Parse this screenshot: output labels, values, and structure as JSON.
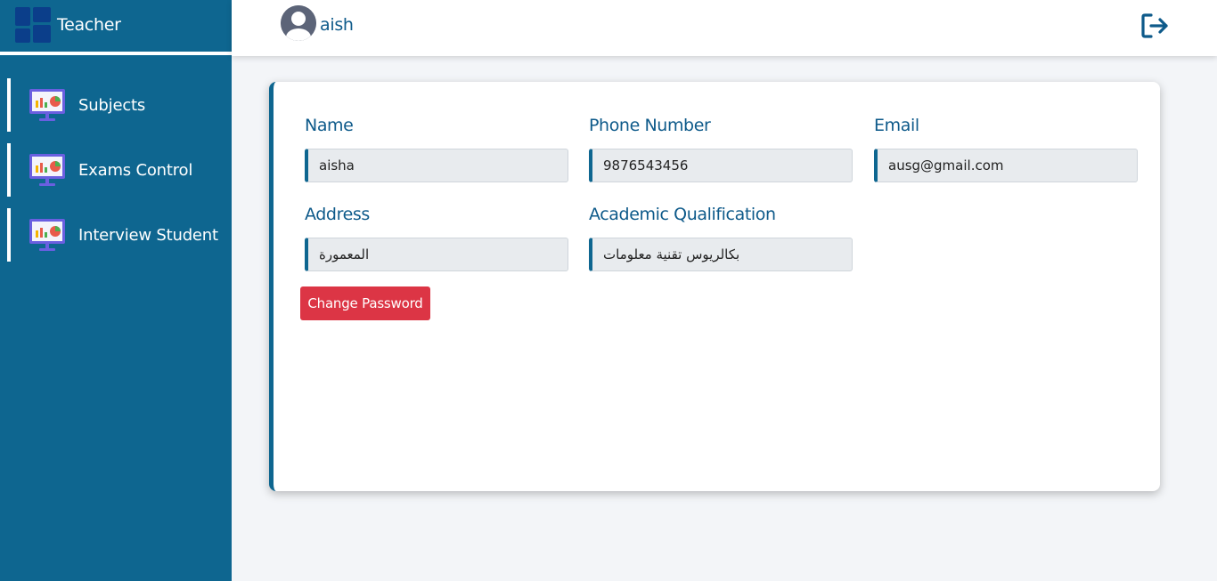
{
  "sidebar": {
    "brand_title": "Teacher",
    "items": [
      {
        "label": "Subjects",
        "icon": "presentation-chart-icon"
      },
      {
        "label": "Exams Control",
        "icon": "presentation-chart-icon"
      },
      {
        "label": "Interview Student",
        "icon": "presentation-chart-icon"
      }
    ]
  },
  "header": {
    "username": "aish",
    "avatar_icon": "user-avatar-icon",
    "logout_icon": "logout-icon"
  },
  "profile": {
    "name": {
      "label": "Name",
      "value": "aisha"
    },
    "phone": {
      "label": "Phone Number",
      "value": "9876543456"
    },
    "email": {
      "label": "Email",
      "value": "ausg@gmail.com"
    },
    "address": {
      "label": "Address",
      "value": "المعمورة"
    },
    "qualification": {
      "label": "Academic Qualification",
      "value": "بكالريوس تقنية معلومات"
    },
    "change_password_label": "Change Password"
  },
  "colors": {
    "sidebar": "#0e6690",
    "accent_text": "#0e5a8a",
    "danger": "#dc3545"
  }
}
